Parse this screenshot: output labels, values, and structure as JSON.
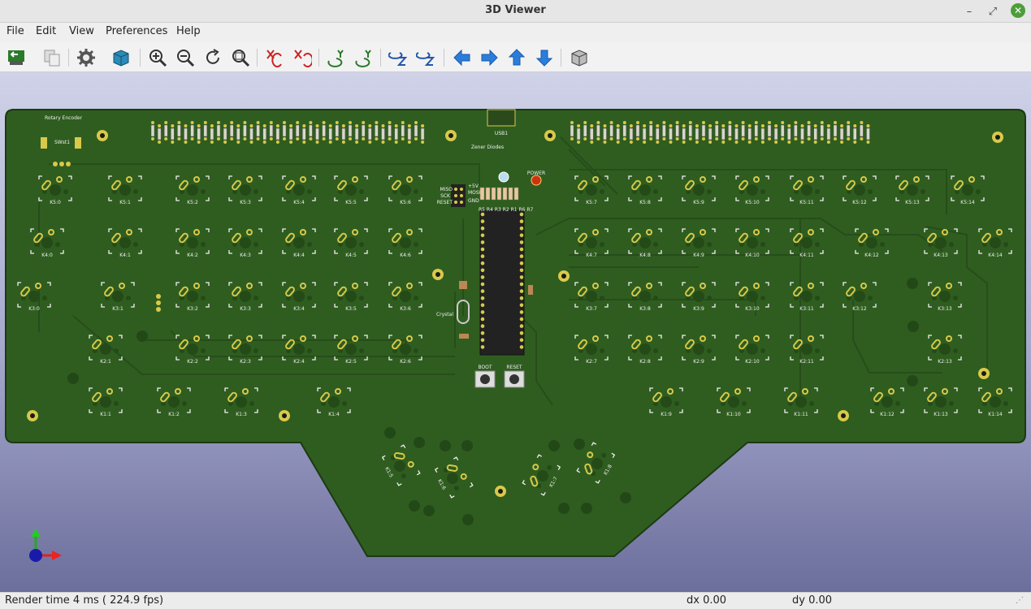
{
  "window": {
    "title": "3D Viewer"
  },
  "menu": [
    "File",
    "Edit",
    "View",
    "Preferences",
    "Help"
  ],
  "toolbar": [
    {
      "name": "reload-board-button",
      "icon": "reload-board-icon"
    },
    {
      "name": "copy-3d-image-button",
      "icon": "copy-icon"
    },
    {
      "name": "display-options-button",
      "icon": "gear-icon"
    },
    {
      "name": "raytracing-button",
      "icon": "render-cube-icon"
    },
    {
      "name": "zoom-in-button",
      "icon": "zoom-in-icon"
    },
    {
      "name": "zoom-out-button",
      "icon": "zoom-out-icon"
    },
    {
      "name": "redraw-button",
      "icon": "refresh-icon"
    },
    {
      "name": "zoom-fit-button",
      "icon": "zoom-fit-icon"
    },
    {
      "name": "rotate-x-cw-button",
      "icon": "rotate-x-icon"
    },
    {
      "name": "rotate-x-ccw-button",
      "icon": "rotate-x-ccw-icon"
    },
    {
      "name": "rotate-y-cw-button",
      "icon": "rotate-y-icon"
    },
    {
      "name": "rotate-y-ccw-button",
      "icon": "rotate-y-ccw-icon"
    },
    {
      "name": "rotate-z-cw-button",
      "icon": "rotate-z-icon"
    },
    {
      "name": "rotate-z-ccw-button",
      "icon": "rotate-z-ccw-icon"
    },
    {
      "name": "move-left-button",
      "icon": "arrow-left-icon"
    },
    {
      "name": "move-right-button",
      "icon": "arrow-right-icon"
    },
    {
      "name": "move-up-button",
      "icon": "arrow-up-icon"
    },
    {
      "name": "move-down-button",
      "icon": "arrow-down-icon"
    },
    {
      "name": "toggle-ortho-button",
      "icon": "ortho-cube-icon"
    }
  ],
  "board": {
    "labels": {
      "rotary_encoder": "Rotary Encoder",
      "sw_rot": "SWst1",
      "usb": "USB1",
      "zener": "Zener Diodes",
      "power": "POWER",
      "boot": "BOOT",
      "reset": "RESET",
      "miso": "MISO",
      "sck": "SCK",
      "reset_pin": "RESET",
      "p5v": "+5V",
      "mosi": "MOSI",
      "gnd": "GND",
      "resistors": "R5 R4 R3 R2 R1 R6 R7",
      "crystal": "Crystal"
    },
    "row5": [
      "K5:0",
      "K5:1",
      "K5:2",
      "K5:3",
      "K5:4",
      "K5:5",
      "K5:6",
      "K5:7",
      "K5:8",
      "K5:9",
      "K5:10",
      "K5:11",
      "K5:12",
      "K5:13",
      "K5:14"
    ],
    "row4": [
      "K4:0",
      "K4:1",
      "K4:2",
      "K4:3",
      "K4:4",
      "K4:5",
      "K4:6",
      "K4:7",
      "K4:8",
      "K4:9",
      "K4:10",
      "K4:11",
      "K4:12",
      "K4:13",
      "K4:14"
    ],
    "row3": [
      "K3:0",
      "K3:1",
      "K3:2",
      "K3:3",
      "K3:4",
      "K3:5",
      "K3:6",
      "K3:7",
      "K3:8",
      "K3:9",
      "K3:10",
      "K3:11",
      "K3:12",
      "K3:13"
    ],
    "row2": [
      "K2:1",
      "K2:2",
      "K2:3",
      "K2:4",
      "K2:5",
      "K2:6",
      "K2:7",
      "K2:8",
      "K2:9",
      "K2:10",
      "K2:11",
      "K2:13"
    ],
    "row1": [
      "K1:1",
      "K1:2",
      "K1:3",
      "K1:4",
      "K1:9",
      "K1:10",
      "K1:11",
      "K1:12",
      "K1:13",
      "K1:14"
    ],
    "thumb": [
      "K1:5",
      "K1:6",
      "K1:7",
      "K1:8"
    ]
  },
  "status": {
    "render_time": "Render time 4 ms ( 224.9 fps)",
    "dx": "dx 0.00",
    "dy": "dy 0.00"
  },
  "colors": {
    "pcb": "#2f5d20",
    "edge": "#1f3f14",
    "pad": "#d8c94a",
    "background_top": "#d0d2e8",
    "background_bottom": "#6c6e9c"
  }
}
